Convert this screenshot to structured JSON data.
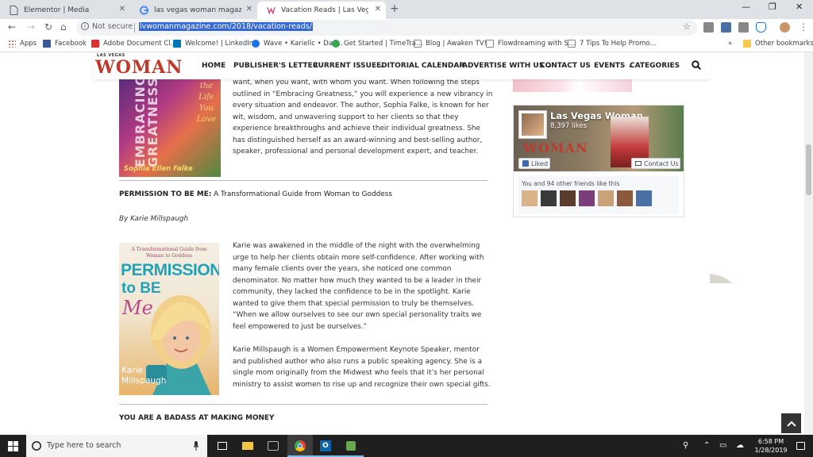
{
  "browser": {
    "tabs": [
      {
        "label": "Elementor | Media"
      },
      {
        "label": "las vegas woman magazine kari…"
      },
      {
        "label": "Vacation Reads | Las Vegas Wom…"
      }
    ],
    "new_tab_label": "+",
    "window_controls": {
      "minimize": "—",
      "maximize": "❐",
      "close": "✕"
    },
    "security_label": "Not secure",
    "url": "lvwomanmagazine.com/2018/vacation-reads/",
    "bookmarks": [
      {
        "label": "Apps",
        "color": "#ea4335"
      },
      {
        "label": "Facebook",
        "color": "#3b5998"
      },
      {
        "label": "Adobe Document Cl…",
        "color": "#e02f2f"
      },
      {
        "label": "Welcome! | LinkedIn",
        "color": "#0077b5"
      },
      {
        "label": "Wave • Kariellc • Das…",
        "color": "#1a73e8"
      },
      {
        "label": "Get Started | TimeTra…",
        "color": "#34a853"
      },
      {
        "label": "Blog | Awaken TV!",
        "color": "#888888"
      },
      {
        "label": "Flowdreaming with S…",
        "color": "#888888"
      },
      {
        "label": "7 Tips To Help Promo…",
        "color": "#888888"
      }
    ],
    "overflow_label": "»",
    "other_bookmarks": "Other bookmarks"
  },
  "site": {
    "logo_small": "LAS VEGAS",
    "logo": "WOMAN",
    "nav": [
      "HOME",
      "PUBLISHER'S LETTER",
      "CURRENT ISSUE ⌄",
      "EDITORIAL CALENDAR",
      "ADVERTISE WITH US ⌄",
      "CONTACT US",
      "EVENTS ⌄",
      "CATEGORIES"
    ]
  },
  "article": {
    "book1": {
      "cover_words": [
        "the",
        "Life",
        "You",
        "Love"
      ],
      "cover_title": "EMBRACING GREATNESS",
      "cover_author": "Sophia Ellen Falke",
      "paragraph_lines": [
        "want, when you want, with whom you want. When following the steps",
        "outlined in “Embracing Greatness,” you will experience a new vibrancy in",
        "every situation and endeavor. The author, Sophia Falke, is known for her",
        "wit, wisdom, and unwavering support to her clients so that they",
        "experience breakthroughs and achieve their individual greatness. She",
        "has distinguished herself as an award-winning and best-selling author,",
        "speaker, professional and personal development expert, and teacher."
      ]
    },
    "book2": {
      "title_bold": "PERMISSION TO BE ME:",
      "title_rest": " A Transformational Guide from Woman to Goddess",
      "byline": "By Karie Millspaugh",
      "cover_subtitle": "A Transformational Guide from Woman to Goddess",
      "cover_title_1": "PERMISSION",
      "cover_title_2": "to BE",
      "cover_title_3": "Me",
      "cover_author_1": "Karie",
      "cover_author_2": "Millspaugh",
      "paragraph1_lines": [
        "Karie was awakened in the middle of the night with the overwhelming",
        "urge to help her clients obtain more self-confidence. After working with",
        "many female clients over the years, she noticed one common",
        "denominator. No matter how much they wanted to be a leader in their",
        "community, they lacked the confidence to be in the spotlight. Karie",
        "wanted to give them that special permission to truly be themselves.",
        "“When we allow ourselves to see our own special personality traits we",
        "feel empowered to just be ourselves.”"
      ],
      "paragraph2_lines": [
        "Karie Millspaugh is a Women Empowerment Keynote Speaker, mentor",
        "and published author who also runs a public speaking agency. She is a",
        "single mom originally from the Midwest who feels that it’s her personal",
        "ministry to assist women to rise up and recognize their own special gifts."
      ]
    },
    "next_section_title": "YOU ARE A BADASS AT MAKING MONEY"
  },
  "fb_widget": {
    "page_name": "Las Vegas Woman",
    "likes": "8,397 likes",
    "cover_logo": "WOMAN",
    "liked_label": "Liked",
    "contact_label": "Contact Us",
    "friends_text": "You and 94 other friends like this",
    "friend_colors": [
      "#d9b48a",
      "#3a3a3a",
      "#5b3b2b",
      "#7a3e7a",
      "#c9a27a",
      "#8b5a3c",
      "#4a6fa5",
      "#6a3d2a"
    ]
  },
  "taskbar": {
    "search_placeholder": "Type here to search",
    "time": "6:58 PM",
    "date": "1/28/2019"
  },
  "colors": {
    "brand_red": "#c0392b",
    "url_highlight": "#3367d6",
    "fb_blue": "#4267b2"
  }
}
